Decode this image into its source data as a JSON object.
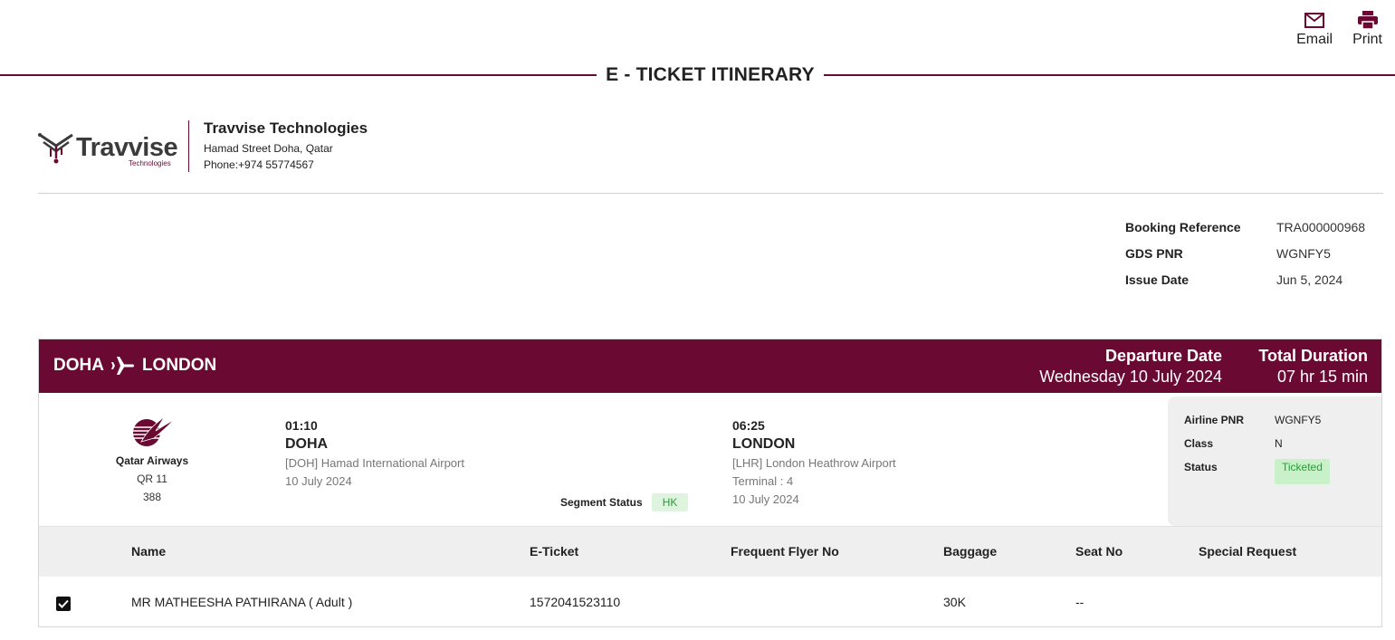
{
  "toolbar": {
    "email_label": "Email",
    "print_label": "Print"
  },
  "page_title": "E - TICKET ITINERARY",
  "company": {
    "logo_text": "Travvise",
    "logo_sub": "Technologies",
    "name": "Travvise Technologies",
    "address": "Hamad Street Doha, Qatar",
    "phone": "Phone:+974 55774567"
  },
  "booking": {
    "ref_label": "Booking Reference",
    "ref_value": "TRA000000968",
    "pnr_label": "GDS PNR",
    "pnr_value": "WGNFY5",
    "issue_label": "Issue Date",
    "issue_value": "Jun 5, 2024"
  },
  "flight": {
    "origin": "DOHA",
    "destination": "LONDON",
    "departure_date_label": "Departure Date",
    "departure_date_value": "Wednesday 10 July 2024",
    "duration_label": "Total Duration",
    "duration_value": "07 hr 15 min",
    "airline_name": "Qatar Airways",
    "flight_no": "QR 11",
    "aircraft": "388",
    "dep_time": "01:10",
    "dep_city": "DOHA",
    "dep_airport": "[DOH] Hamad International Airport",
    "dep_date": "10 July 2024",
    "arr_time": "06:25",
    "arr_city": "LONDON",
    "arr_airport": "[LHR] London Heathrow Airport",
    "arr_terminal": "Terminal : 4",
    "arr_date": "10 July 2024",
    "segment_status_label": "Segment Status",
    "segment_status_value": "HK",
    "airline_pnr_label": "Airline PNR",
    "airline_pnr_value": "WGNFY5",
    "class_label": "Class",
    "class_value": "N",
    "status_label": "Status",
    "status_value": "Ticketed"
  },
  "passengers": {
    "headers": [
      "Name",
      "E-Ticket",
      "Frequent Flyer No",
      "Baggage",
      "Seat No",
      "Special Request"
    ],
    "rows": [
      {
        "checked": true,
        "name": "MR MATHEESHA PATHIRANA ( Adult )",
        "eticket": "1572041523110",
        "ffn": "",
        "baggage": "30K",
        "seat": "--",
        "special": ""
      }
    ]
  },
  "colors": {
    "brand": "#6a0a33",
    "status_green_bg": "#c9f1c9",
    "status_green_text": "#2b9a3a"
  },
  "icons": [
    "mail-icon",
    "printer-icon",
    "plane-icon",
    "qatar-oryx-logo",
    "check-icon"
  ]
}
